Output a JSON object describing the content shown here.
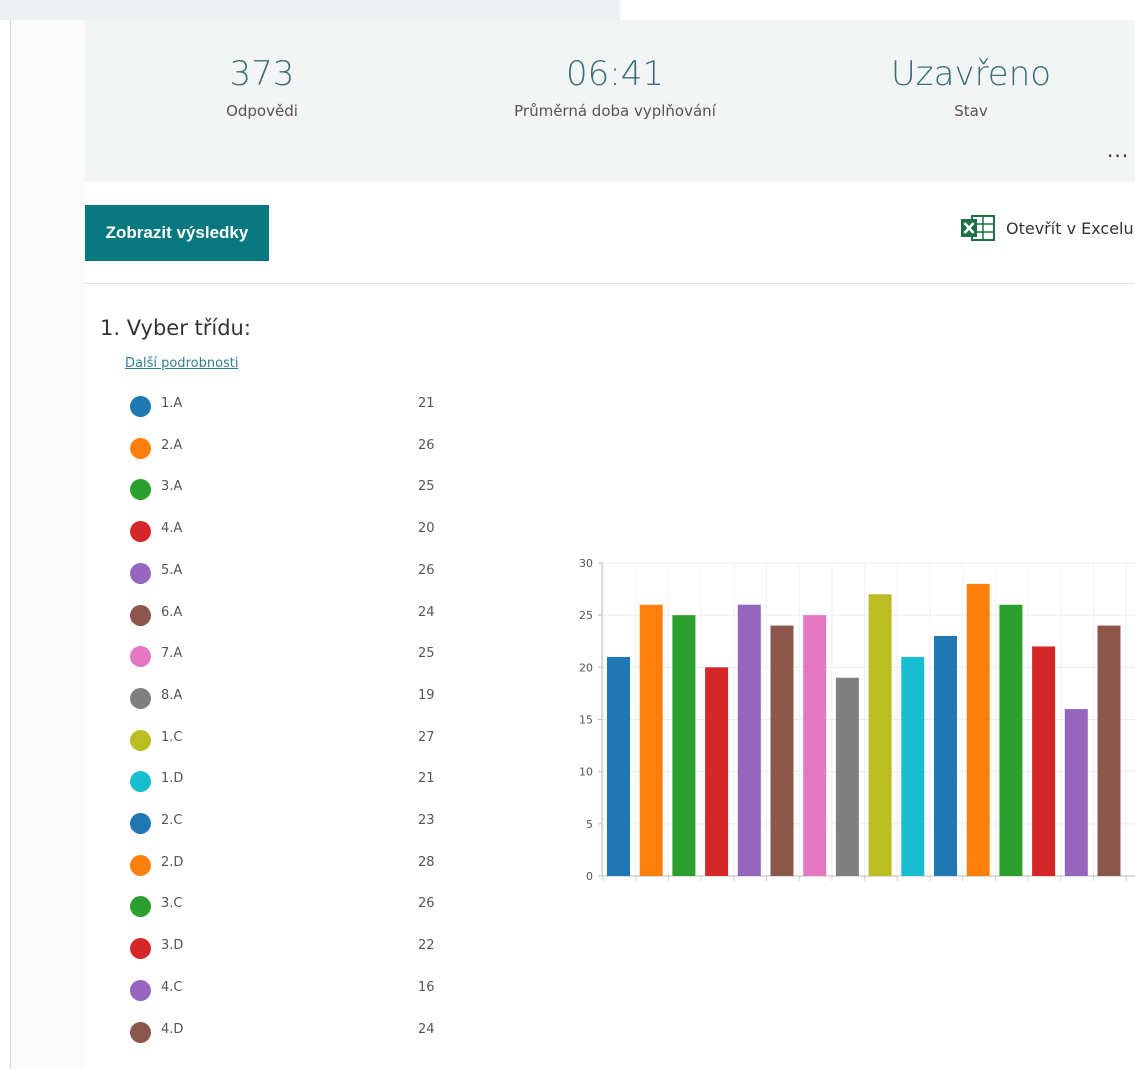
{
  "summary": {
    "responses_value": "373",
    "responses_label": "Odpovědi",
    "avg_time_value": "06:41",
    "avg_time_label": "Průměrná doba vyplňování",
    "status_value": "Uzavřeno",
    "status_label": "Stav",
    "more_label": "..."
  },
  "toolbar": {
    "view_results_label": "Zobrazit výsledky",
    "open_excel_label": "Otevřít v Excelu",
    "excel_icon": "excel-icon"
  },
  "question": {
    "title": "1.  Vyber třídu:",
    "more_details_label": "Další podrobnosti"
  },
  "colors": {
    "accent": "#08787f",
    "stat_text": "#3a6e7a"
  },
  "chart_data": {
    "type": "bar",
    "categories": [
      "1.A",
      "2.A",
      "3.A",
      "4.A",
      "5.A",
      "6.A",
      "7.A",
      "8.A",
      "1.C",
      "1.D",
      "2.C",
      "2.D",
      "3.C",
      "3.D",
      "4.C",
      "4.D"
    ],
    "values": [
      21,
      26,
      25,
      20,
      26,
      24,
      25,
      19,
      27,
      21,
      23,
      28,
      26,
      22,
      16,
      24
    ],
    "colors": [
      "#1f77b4",
      "#ff7f0e",
      "#2ca02c",
      "#d62728",
      "#9467bd",
      "#8c564b",
      "#e377c2",
      "#7f7f7f",
      "#bcbd22",
      "#17becf",
      "#1f77b4",
      "#ff7f0e",
      "#2ca02c",
      "#d62728",
      "#9467bd",
      "#8c564b"
    ],
    "yticks": [
      "0",
      "5",
      "10",
      "15",
      "20",
      "25",
      "30"
    ],
    "ylim": [
      0,
      30
    ],
    "grid": true
  }
}
